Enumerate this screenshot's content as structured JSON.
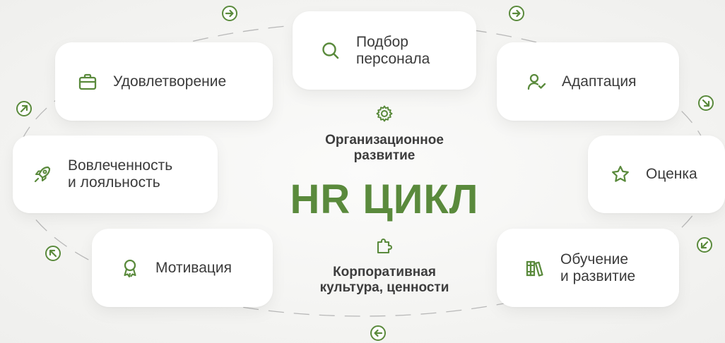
{
  "center": {
    "subtitle_top": "Организационное\nразвитие",
    "title": "HR ЦИКЛ",
    "subtitle_bottom": "Корпоративная\nкультура, ценности",
    "icon_top": "gear-icon",
    "icon_bottom": "puzzle-icon"
  },
  "stages": [
    {
      "id": "recruitment",
      "label": "Подбор\nперсонала",
      "icon": "search-icon"
    },
    {
      "id": "adaptation",
      "label": "Адаптация",
      "icon": "user-check-icon"
    },
    {
      "id": "assessment",
      "label": "Оценка",
      "icon": "star-icon"
    },
    {
      "id": "training",
      "label": "Обучение\nи развитие",
      "icon": "books-icon"
    },
    {
      "id": "motivation",
      "label": "Мотивация",
      "icon": "award-icon"
    },
    {
      "id": "engagement",
      "label": "Вовлеченность\nи лояльность",
      "icon": "rocket-icon"
    },
    {
      "id": "satisfaction",
      "label": "Удовлетворение",
      "icon": "briefcase-icon"
    }
  ],
  "colors": {
    "accent": "#5a8a3c",
    "text": "#3b3b3b",
    "card": "#ffffff",
    "ring": "#b5b5b5"
  }
}
